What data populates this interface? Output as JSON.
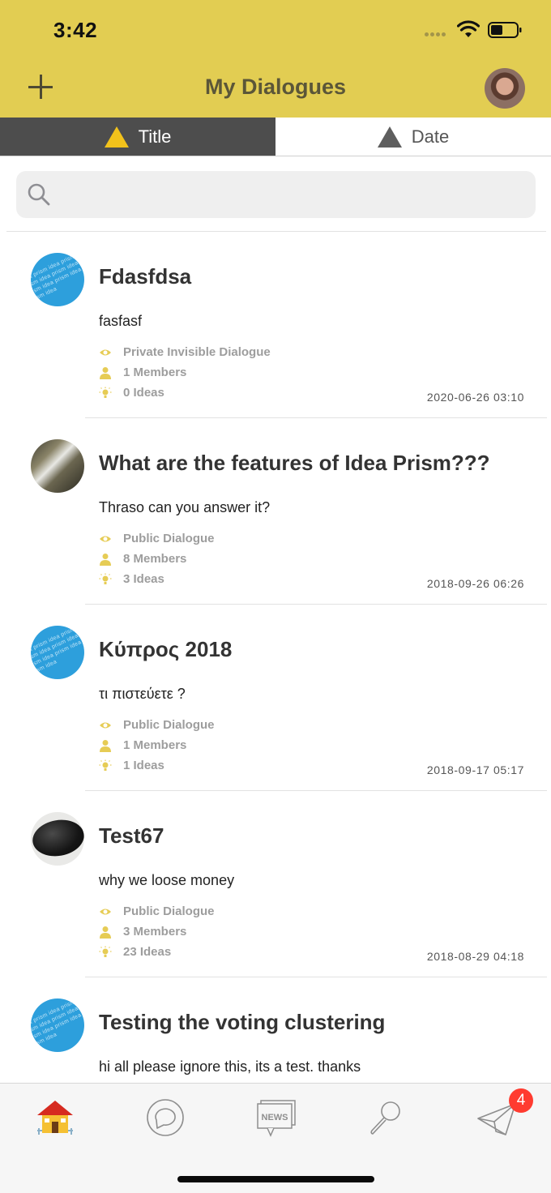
{
  "status_bar": {
    "time": "3:42"
  },
  "header": {
    "title": "My Dialogues"
  },
  "sort_tabs": [
    {
      "label": "Title",
      "active": true
    },
    {
      "label": "Date",
      "active": false
    }
  ],
  "search": {
    "placeholder": ""
  },
  "dialogues": [
    {
      "title": "Fdasfdsa",
      "description": "fasfasf",
      "visibility": "Private Invisible Dialogue",
      "members": "1 Members",
      "ideas": "0 Ideas",
      "date": "2020-06-26 03:10",
      "avatar": "idea-prism-logo"
    },
    {
      "title": "What are the features of Idea Prism???",
      "description": "Thraso can you answer it?",
      "visibility": "Public Dialogue",
      "members": "8 Members",
      "ideas": "3 Ideas",
      "date": "2018-09-26 06:26",
      "avatar": "waterfall-photo"
    },
    {
      "title": "Κύπρος 2018",
      "description": "τι πιστεύετε ?",
      "visibility": "Public Dialogue",
      "members": "1 Members",
      "ideas": "1 Ideas",
      "date": "2018-09-17 05:17",
      "avatar": "idea-prism-logo"
    },
    {
      "title": "Test67",
      "description": "why we loose money",
      "visibility": "Public Dialogue",
      "members": "3 Members",
      "ideas": "23 Ideas",
      "date": "2018-08-29 04:18",
      "avatar": "mouse-photo"
    },
    {
      "title": "Testing the voting clustering",
      "description": "hi all please ignore this, its a test. thanks",
      "avatar": "idea-prism-logo"
    }
  ],
  "prism_logo_text": "idea prism idea prism idea prism idea prism idea prism idea prism idea prism idea",
  "tab_bar": {
    "items": [
      {
        "name": "home",
        "icon": "house-icon"
      },
      {
        "name": "dialogues",
        "icon": "speech-bubble-icon"
      },
      {
        "name": "news",
        "icon": "news-icon",
        "label": "NEWS"
      },
      {
        "name": "search",
        "icon": "magnifier-icon"
      },
      {
        "name": "messages",
        "icon": "paper-plane-icon"
      }
    ],
    "badge": "4"
  },
  "colors": {
    "header": "#e2cd52",
    "accent": "#f2c21b",
    "badge": "#ff3b30",
    "active_tab": "#4d4d4d"
  }
}
